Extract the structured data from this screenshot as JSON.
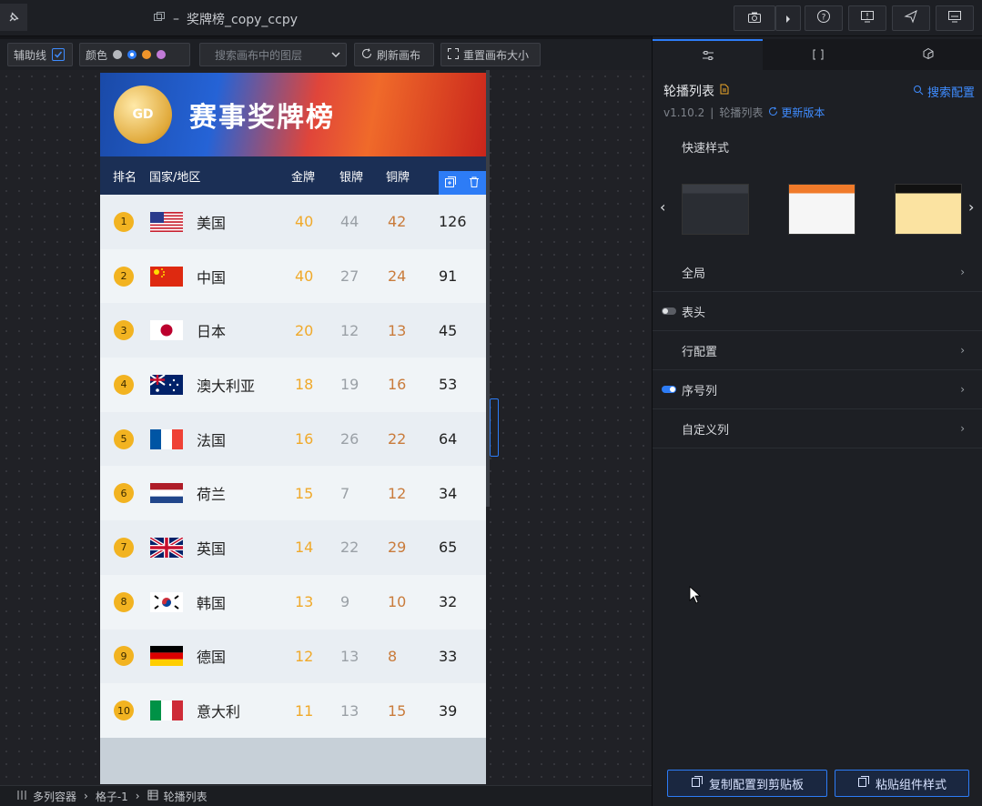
{
  "document": {
    "title": "奖牌榜_copy_ccpy",
    "separator": "–"
  },
  "toolbar": {
    "guides_label": "辅助线",
    "color_label": "颜色",
    "layer_search_placeholder": "搜索画布中的图层",
    "refresh_label": "刷新画布",
    "reset_size_label": "重置画布大小"
  },
  "canvas": {
    "banner_title": "赛事奖牌榜",
    "medal_text": "GD",
    "headers": {
      "rank": "排名",
      "country": "国家/地区",
      "gold": "金牌",
      "silver": "银牌",
      "bronze": "铜牌"
    },
    "rows": [
      {
        "rank": "1",
        "country": "美国",
        "gold": "40",
        "silver": "44",
        "bronze": "42",
        "total": "126",
        "flag": "us"
      },
      {
        "rank": "2",
        "country": "中国",
        "gold": "40",
        "silver": "27",
        "bronze": "24",
        "total": "91",
        "flag": "cn"
      },
      {
        "rank": "3",
        "country": "日本",
        "gold": "20",
        "silver": "12",
        "bronze": "13",
        "total": "45",
        "flag": "jp"
      },
      {
        "rank": "4",
        "country": "澳大利亚",
        "gold": "18",
        "silver": "19",
        "bronze": "16",
        "total": "53",
        "flag": "au"
      },
      {
        "rank": "5",
        "country": "法国",
        "gold": "16",
        "silver": "26",
        "bronze": "22",
        "total": "64",
        "flag": "fr"
      },
      {
        "rank": "6",
        "country": "荷兰",
        "gold": "15",
        "silver": "7",
        "bronze": "12",
        "total": "34",
        "flag": "nl"
      },
      {
        "rank": "7",
        "country": "英国",
        "gold": "14",
        "silver": "22",
        "bronze": "29",
        "total": "65",
        "flag": "gb"
      },
      {
        "rank": "8",
        "country": "韩国",
        "gold": "13",
        "silver": "9",
        "bronze": "10",
        "total": "32",
        "flag": "kr"
      },
      {
        "rank": "9",
        "country": "德国",
        "gold": "12",
        "silver": "13",
        "bronze": "8",
        "total": "33",
        "flag": "de"
      },
      {
        "rank": "10",
        "country": "意大利",
        "gold": "11",
        "silver": "13",
        "bronze": "15",
        "total": "39",
        "flag": "it"
      }
    ]
  },
  "breadcrumb": {
    "items": [
      "多列容器",
      "格子-1",
      "轮播列表"
    ]
  },
  "panel": {
    "component_name": "轮播列表",
    "version": "v1.10.2",
    "sub_name": "轮播列表",
    "update_label": "更新版本",
    "search_config_label": "搜索配置",
    "quick_style_label": "快速样式",
    "sections": {
      "global": "全局",
      "header": "表头",
      "row_config": "行配置",
      "index_col": "序号列",
      "custom_col": "自定义列"
    },
    "copy_btn": "复制配置到剪贴板",
    "paste_btn": "粘贴组件样式"
  },
  "colors": {
    "accent": "#2d7cf6",
    "gold": "#f0a92a",
    "silver": "#9aa0a6",
    "bronze": "#c97b3b",
    "rank_badge": "#f2b321",
    "header_row": "#1b2f55",
    "swatch_1": "#b5b8bd",
    "swatch_2": "#2d7cf6",
    "swatch_3": "#f0952a",
    "swatch_4": "#c27bd8"
  }
}
